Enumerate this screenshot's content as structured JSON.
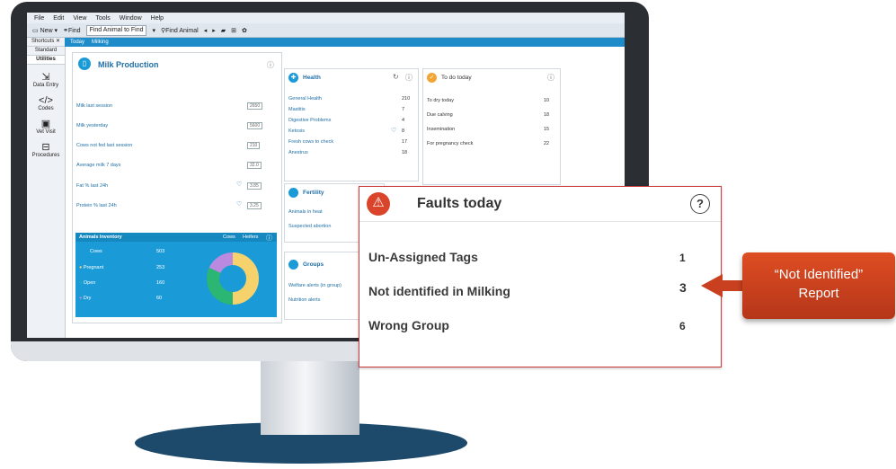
{
  "menubar": {
    "items": [
      "File",
      "Edit",
      "View",
      "Tools",
      "Window",
      "Help"
    ]
  },
  "toolbar": {
    "new_label": "New",
    "find_label": "Find",
    "find_field": "Find Animal to Find",
    "find_animal_label": "Find Animal"
  },
  "shortcuts": {
    "header": "Shortcuts",
    "standard_label": "Standard",
    "utilities_label": "Utilities",
    "items": [
      {
        "label": "Data Entry",
        "icon": "data-entry-icon"
      },
      {
        "label": "Codes",
        "icon": "code-icon"
      },
      {
        "label": "Vet Visit",
        "icon": "vet-kit-icon"
      },
      {
        "label": "Procedures",
        "icon": "procedures-icon"
      }
    ]
  },
  "tabs": [
    "Today",
    "Milking"
  ],
  "milk_panel": {
    "title": "Milk Production",
    "rows": [
      {
        "label": "Milk last session",
        "value": "2650"
      },
      {
        "label": "Milk yesterday",
        "value": "5600"
      },
      {
        "label": "Cows not fed last session",
        "value": "210"
      },
      {
        "label": "Average milk 7 days",
        "value": "32.0"
      },
      {
        "label": "Fat % last 24h",
        "value": "3.85"
      },
      {
        "label": "Protein % last 24h",
        "value": "3.25"
      }
    ],
    "inventory": {
      "title": "Animals Inventory",
      "links": [
        "Cows",
        "Heifers"
      ],
      "rows": [
        {
          "label": "Cows",
          "value": "503"
        },
        {
          "label": "Pregnant",
          "value": "253"
        },
        {
          "label": "Open",
          "value": "160"
        },
        {
          "label": "Dry",
          "value": "60"
        }
      ]
    }
  },
  "health_panel": {
    "title": "Health",
    "rows": [
      {
        "label": "General Health",
        "value": "210"
      },
      {
        "label": "Mastitis",
        "value": "7"
      },
      {
        "label": "Digestive Problems",
        "value": "4"
      },
      {
        "label": "Ketosis",
        "value": "8"
      },
      {
        "label": "Fresh cows to check",
        "value": "17"
      },
      {
        "label": "Anestrus",
        "value": "18"
      }
    ]
  },
  "fertility_panel": {
    "title": "Fertility",
    "rows": [
      "Animals in heat",
      "Suspected abortion"
    ]
  },
  "groups_panel": {
    "title": "Groups",
    "rows": [
      "Welfare alerts (in group)",
      "Nutrition alerts"
    ]
  },
  "todo_panel": {
    "title": "To do today",
    "rows": [
      {
        "label": "To dry today",
        "value": "10"
      },
      {
        "label": "Due calving",
        "value": "18"
      },
      {
        "label": "Insemination",
        "value": "15"
      },
      {
        "label": "For pregnancy check",
        "value": "22"
      }
    ]
  },
  "faults_panel": {
    "title": "Faults today",
    "rows": [
      {
        "label": "Un-Assigned Tags",
        "count": "1"
      },
      {
        "label": "Not identified in Milking",
        "count": "3"
      },
      {
        "label": "Wrong Group",
        "count": "6"
      }
    ]
  },
  "report_callout": {
    "line1": "“Not Identified”",
    "line2": "Report"
  },
  "colors": {
    "accent": "#1a9bd7",
    "alert_red": "#d9442b",
    "todo_orange": "#f2a535"
  }
}
